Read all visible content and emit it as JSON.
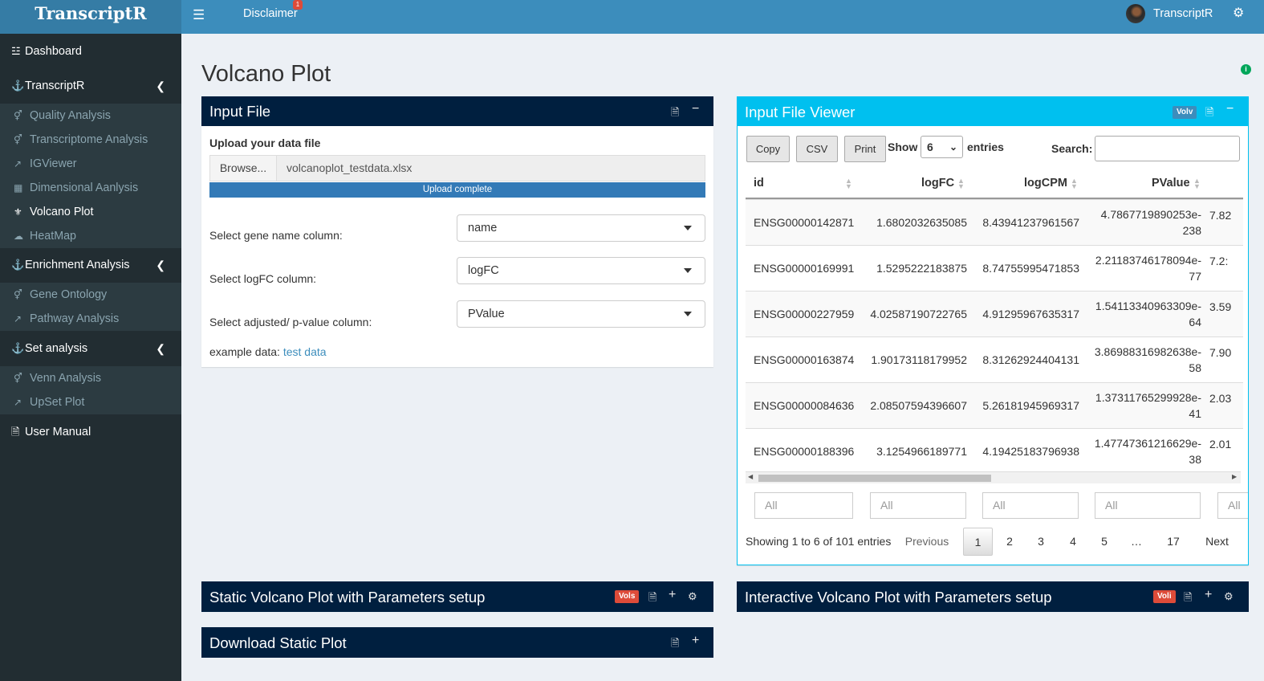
{
  "app": {
    "logo": "TranscriptR",
    "menu_icon": "hamburger-icon"
  },
  "topbar": {
    "disclaimer": "Disclaimer",
    "disclaimer_badge": "1",
    "user": "TranscriptR"
  },
  "sidebar": {
    "dashboard": "Dashboard",
    "transcriptr": "TranscriptR",
    "transcriptr_items": [
      "Quality Analysis",
      "Transcriptome Analysis",
      "IGViewer",
      "Dimensional Aanlysis",
      "Volcano Plot",
      "HeatMap"
    ],
    "enrichment": "Enrichment Analysis",
    "enrichment_items": [
      "Gene Ontology",
      "Pathway Analysis"
    ],
    "set": "Set analysis",
    "set_items": [
      "Venn Analysis",
      "UpSet Plot"
    ],
    "manual": "User Manual",
    "active_item": "Volcano Plot"
  },
  "page": {
    "title": "Volcano Plot"
  },
  "input_box": {
    "title": "Input File",
    "upload_label": "Upload your data file",
    "browse": "Browse...",
    "filename": "volcanoplot_testdata.xlsx",
    "progress_text": "Upload complete",
    "progress": 1.0,
    "gene_label": "Select gene name column:",
    "gene_value": "name",
    "logfc_label": "Select logFC column:",
    "logfc_value": "logFC",
    "pval_label": "Select adjusted/ p-value column:",
    "pval_value": "PValue",
    "example_prefix": "example data:",
    "example_link": "test data"
  },
  "viewer": {
    "title": "Input File Viewer",
    "badge": "Volv",
    "buttons": {
      "copy": "Copy",
      "csv": "CSV",
      "print": "Print"
    },
    "show": "Show",
    "show_value": "6",
    "entries": "entries",
    "search": "Search:",
    "columns": [
      "id",
      "logFC",
      "logCPM",
      "PValue"
    ],
    "rows": [
      {
        "id": "ENSG00000142871",
        "logFC": "1.6802032635085",
        "logCPM": "8.43941237961567",
        "p1": "4.7867719890253e-",
        "p2": "238",
        "extra": "7.82"
      },
      {
        "id": "ENSG00000169991",
        "logFC": "1.5295222183875",
        "logCPM": "8.74755995471853",
        "p1": "2.21183746178094e-",
        "p2": "77",
        "extra": "7.2:"
      },
      {
        "id": "ENSG00000227959",
        "logFC": "4.02587190722765",
        "logCPM": "4.91295967635317",
        "p1": "1.54113340963309e-",
        "p2": "64",
        "extra": "3.59"
      },
      {
        "id": "ENSG00000163874",
        "logFC": "1.90173118179952",
        "logCPM": "8.31262924404131",
        "p1": "3.86988316982638e-",
        "p2": "58",
        "extra": "7.90"
      },
      {
        "id": "ENSG00000084636",
        "logFC": "2.08507594396607",
        "logCPM": "5.26181945969317",
        "p1": "1.37311765299928e-",
        "p2": "41",
        "extra": "2.03"
      },
      {
        "id": "ENSG00000188396",
        "logFC": "3.1254966189771",
        "logCPM": "4.19425183796938",
        "p1": "1.47747361216629e-",
        "p2": "38",
        "extra": "2.01"
      }
    ],
    "filters": [
      "All",
      "All",
      "All",
      "All",
      "All"
    ],
    "showing": "Showing 1 to 6 of 101 entries",
    "pagination": {
      "previous": "Previous",
      "pages": [
        "1",
        "2",
        "3",
        "4",
        "5",
        "…",
        "17"
      ],
      "next": "Next",
      "current": "1"
    }
  },
  "static_box": {
    "title": "Static Volcano Plot with Parameters setup",
    "badge": "Vols"
  },
  "interactive_box": {
    "title": "Interactive Volcano Plot with Parameters setup",
    "badge": "Voli"
  },
  "download_box": {
    "title": "Download Static Plot"
  },
  "colors": {
    "header": "#3c8dbc",
    "logo": "#357ca5",
    "sidebar": "#222d32",
    "navy": "#001f3f",
    "aqua": "#00c0ef",
    "red": "#dd4b39"
  }
}
